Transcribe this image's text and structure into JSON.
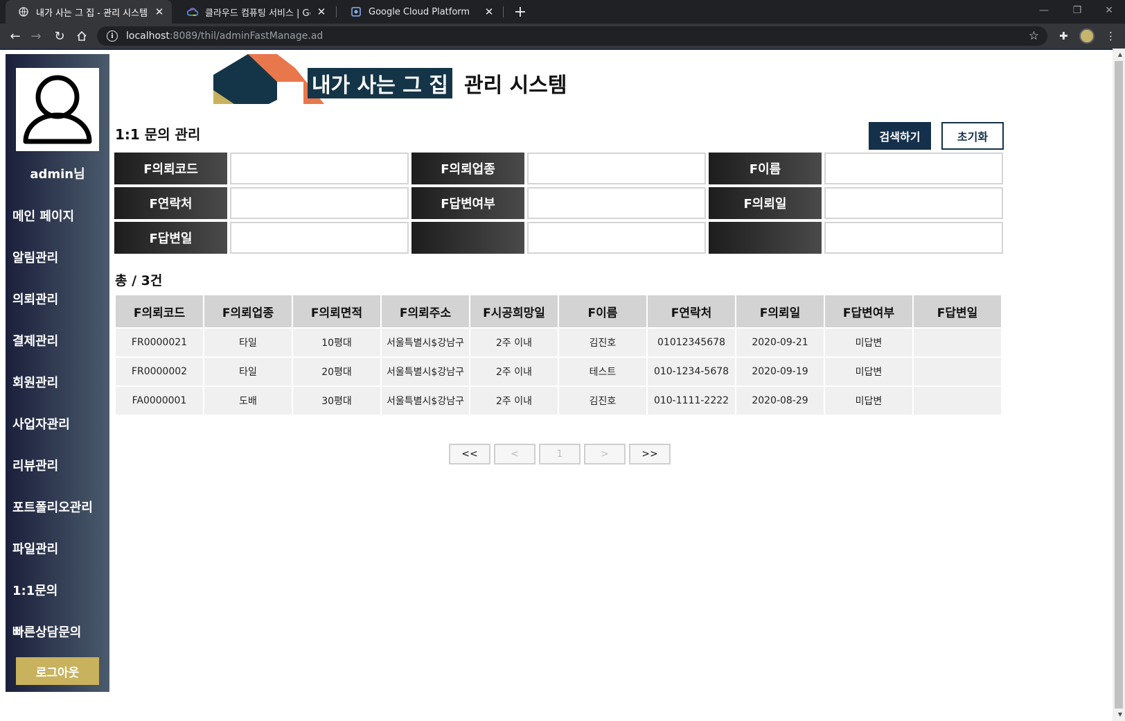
{
  "browser": {
    "tabs": [
      {
        "title": "내가 사는 그 집 - 관리 시스템",
        "active": true
      },
      {
        "title": "클라우드 컴퓨팅 서비스 | Goo",
        "active": false
      },
      {
        "title": "Google Cloud Platform",
        "active": false
      }
    ],
    "url_host": "localhost",
    "url_path": ":8089/thil/adminFastManage.ad"
  },
  "sidebar": {
    "user": "admin님",
    "items": [
      "메인 페이지",
      "알림관리",
      "의뢰관리",
      "결제관리",
      "회원관리",
      "사업자관리",
      "리뷰관리",
      "포트폴리오관리",
      "파일관리",
      "1:1문의",
      "빠른상담문의"
    ],
    "logout": "로그아웃"
  },
  "logo": {
    "highlight": "내가 사는 그 집",
    "rest": "관리 시스템"
  },
  "main": {
    "title": "1:1 문의 관리",
    "search_button": "검색하기",
    "reset_button": "초기화",
    "filters": [
      {
        "label": "F의뢰코드",
        "value": ""
      },
      {
        "label": "F의뢰업종",
        "value": ""
      },
      {
        "label": "F이름",
        "value": ""
      },
      {
        "label": "F연락처",
        "value": ""
      },
      {
        "label": "F답변여부",
        "value": ""
      },
      {
        "label": "F의뢰일",
        "value": ""
      },
      {
        "label": "F답변일",
        "value": ""
      },
      {
        "label": "",
        "value": ""
      },
      {
        "label": "",
        "value": ""
      }
    ],
    "total": "총 / 3건",
    "table": {
      "headers": [
        "F의뢰코드",
        "F의뢰업종",
        "F의뢰면적",
        "F의뢰주소",
        "F시공희망일",
        "F이름",
        "F연락처",
        "F의뢰일",
        "F답변여부",
        "F답변일"
      ],
      "rows": [
        [
          "FR0000021",
          "타일",
          "10평대",
          "서울특별시$강남구",
          "2주 이내",
          "김진호",
          "01012345678",
          "2020-09-21",
          "미답변",
          ""
        ],
        [
          "FR0000002",
          "타일",
          "20평대",
          "서울특별시$강남구",
          "2주 이내",
          "테스트",
          "010-1234-5678",
          "2020-09-19",
          "미답변",
          ""
        ],
        [
          "FA0000001",
          "도배",
          "30평대",
          "서울특별시$강남구",
          "2주 이내",
          "김진호",
          "010-1111-2222",
          "2020-08-29",
          "미답변",
          ""
        ]
      ]
    },
    "pager": {
      "first": "<<",
      "prev": "<",
      "current": "1",
      "next": ">",
      "last": ">>"
    }
  },
  "colors": {
    "sidebar_dark": "#1b1f3b",
    "sidebar_light": "#4a5b6c",
    "navy": "#15304a",
    "gold": "#c8b25d",
    "logo_orange": "#e9774c"
  }
}
